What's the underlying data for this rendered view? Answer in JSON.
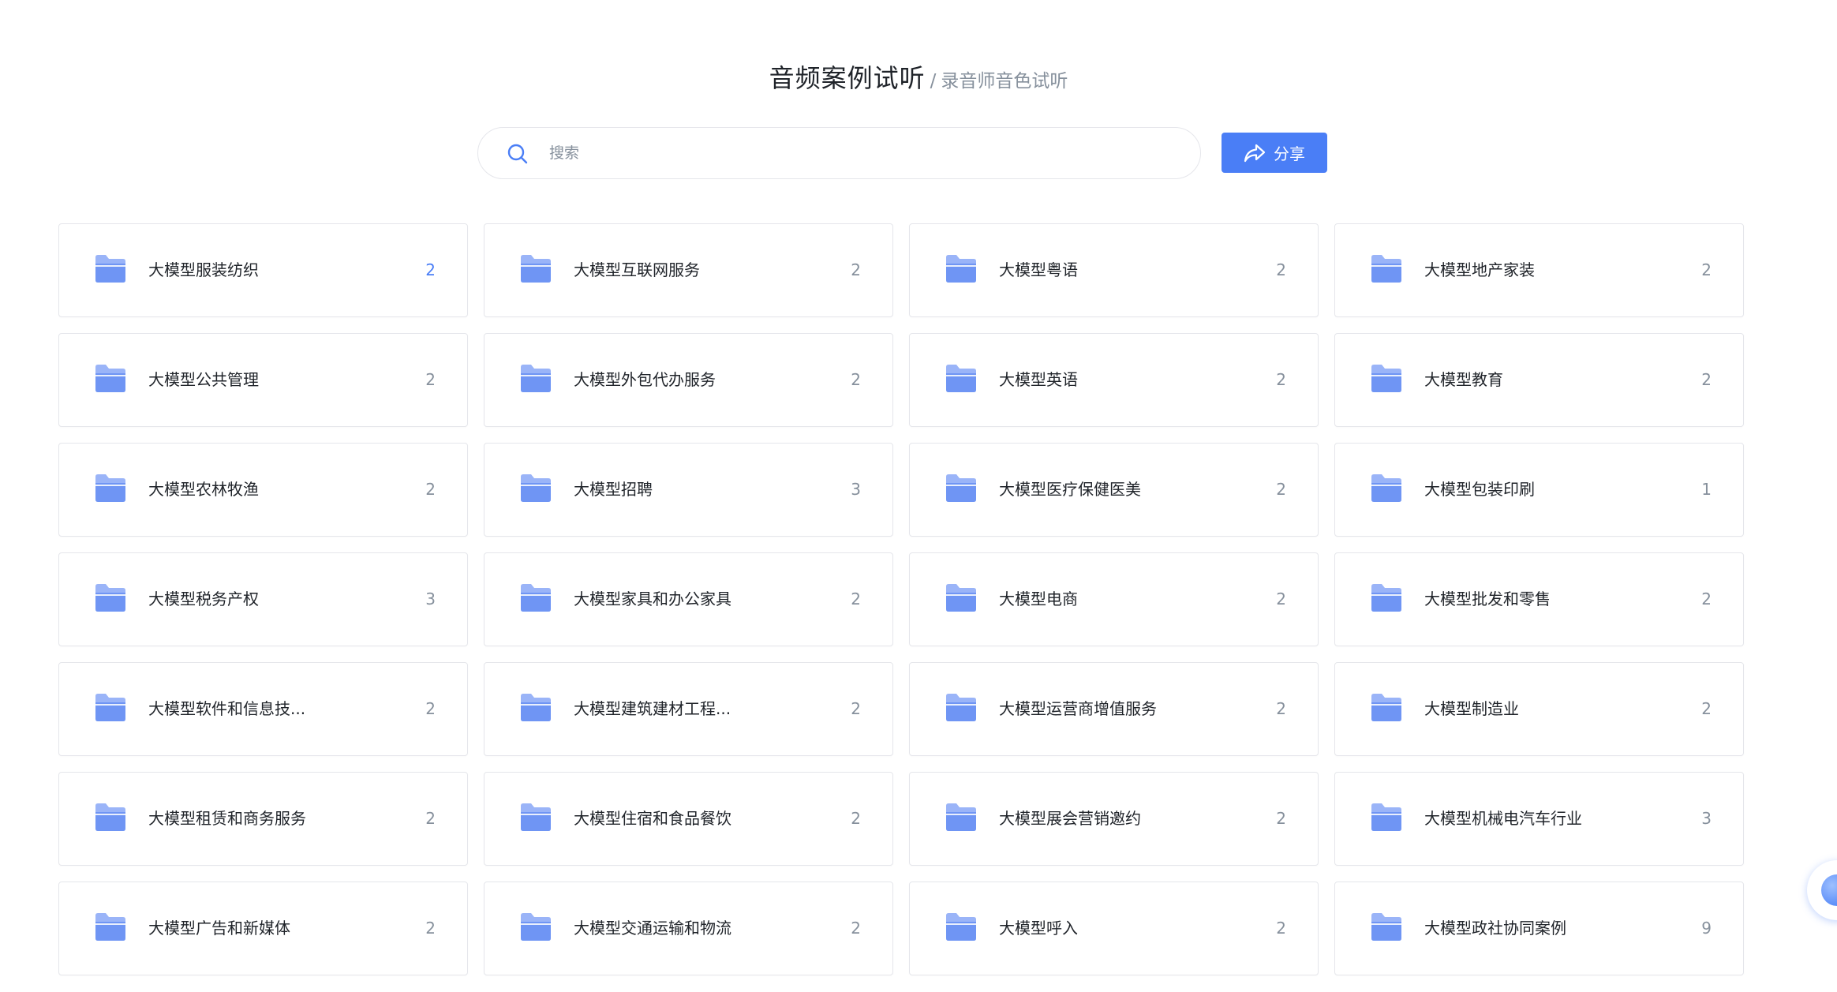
{
  "header": {
    "title": "音频案例试听",
    "separator": "/",
    "subtitle": "录音师音色试听"
  },
  "search": {
    "placeholder": "搜索",
    "value": ""
  },
  "share": {
    "label": "分享"
  },
  "colors": {
    "accent": "#4a7ef6",
    "folder": "#7b9cf6",
    "count_gray": "#86909c"
  },
  "folders": [
    {
      "label": "大模型服装纺织",
      "count": "2"
    },
    {
      "label": "大模型互联网服务",
      "count": "2"
    },
    {
      "label": "大模型粤语",
      "count": "2"
    },
    {
      "label": "大模型地产家装",
      "count": "2"
    },
    {
      "label": "大模型公共管理",
      "count": "2"
    },
    {
      "label": "大模型外包代办服务",
      "count": "2"
    },
    {
      "label": "大模型英语",
      "count": "2"
    },
    {
      "label": "大模型教育",
      "count": "2"
    },
    {
      "label": "大模型农林牧渔",
      "count": "2"
    },
    {
      "label": "大模型招聘",
      "count": "3"
    },
    {
      "label": "大模型医疗保健医美",
      "count": "2"
    },
    {
      "label": "大模型包装印刷",
      "count": "1"
    },
    {
      "label": "大模型税务产权",
      "count": "3"
    },
    {
      "label": "大模型家具和办公家具",
      "count": "2"
    },
    {
      "label": "大模型电商",
      "count": "2"
    },
    {
      "label": "大模型批发和零售",
      "count": "2"
    },
    {
      "label": "大模型软件和信息技...",
      "count": "2"
    },
    {
      "label": "大模型建筑建材工程...",
      "count": "2"
    },
    {
      "label": "大模型运营商增值服务",
      "count": "2"
    },
    {
      "label": "大模型制造业",
      "count": "2"
    },
    {
      "label": "大模型租赁和商务服务",
      "count": "2"
    },
    {
      "label": "大模型住宿和食品餐饮",
      "count": "2"
    },
    {
      "label": "大模型展会营销邀约",
      "count": "2"
    },
    {
      "label": "大模型机械电汽车行业",
      "count": "3"
    },
    {
      "label": "大模型广告和新媒体",
      "count": "2"
    },
    {
      "label": "大模型交通运输和物流",
      "count": "2"
    },
    {
      "label": "大模型呼入",
      "count": "2"
    },
    {
      "label": "大模型政社协同案例",
      "count": "9"
    }
  ]
}
